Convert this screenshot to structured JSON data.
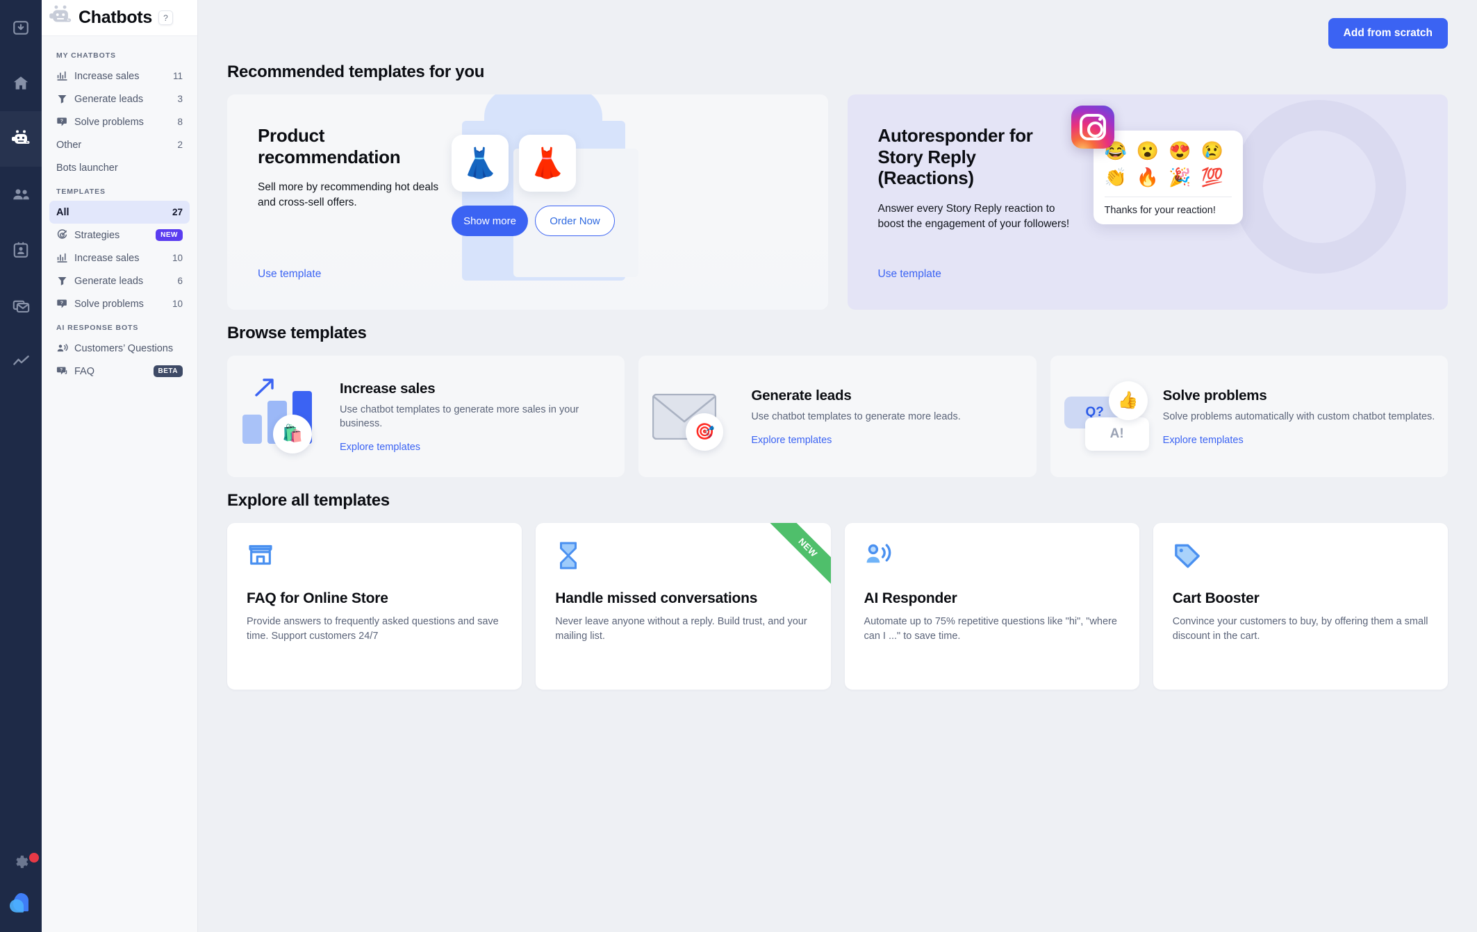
{
  "rail": {
    "items": [
      {
        "icon": "inbox-download-icon",
        "name": "rail-item-archive",
        "active": false
      },
      {
        "icon": "home-icon",
        "name": "rail-item-home",
        "active": false
      },
      {
        "icon": "chatbot-icon",
        "name": "rail-item-chatbots",
        "active": true
      },
      {
        "icon": "team-icon",
        "name": "rail-item-team",
        "active": false
      },
      {
        "icon": "contact-card-icon",
        "name": "rail-item-contacts",
        "active": false
      },
      {
        "icon": "mail-icon",
        "name": "rail-item-campaigns",
        "active": false
      },
      {
        "icon": "chart-line-icon",
        "name": "rail-item-reports",
        "active": false
      }
    ],
    "settings_icon": "gear-icon",
    "brand_icon": "livechat-logo-icon"
  },
  "header": {
    "title": "Chatbots",
    "logo_icon": "chatbot-avatar-icon",
    "help_label": "?"
  },
  "sidebar": {
    "groups": [
      {
        "heading": "MY CHATBOTS",
        "items": [
          {
            "label": "Increase sales",
            "count": "11",
            "icon": "increase-sales-icon"
          },
          {
            "label": "Generate leads",
            "count": "3",
            "icon": "funnel-icon"
          },
          {
            "label": "Solve problems",
            "count": "8",
            "icon": "question-bubble-icon"
          },
          {
            "label": "Other",
            "count": "2",
            "icon": ""
          },
          {
            "label": "Bots launcher",
            "count": "",
            "icon": ""
          }
        ]
      },
      {
        "heading": "TEMPLATES",
        "items": [
          {
            "label": "All",
            "count": "27",
            "icon": "",
            "selected": true
          },
          {
            "label": "Strategies",
            "badge": "NEW",
            "badge_type": "new",
            "icon": "target-icon"
          },
          {
            "label": "Increase sales",
            "count": "10",
            "icon": "increase-sales-icon"
          },
          {
            "label": "Generate leads",
            "count": "6",
            "icon": "funnel-icon"
          },
          {
            "label": "Solve problems",
            "count": "10",
            "icon": "question-bubble-icon"
          }
        ]
      },
      {
        "heading": "AI RESPONSE BOTS",
        "items": [
          {
            "label": "Customers’ Questions",
            "count": "",
            "icon": "person-speaking-icon"
          },
          {
            "label": "FAQ",
            "badge": "BETA",
            "badge_type": "beta",
            "icon": "faq-bubble-icon"
          }
        ]
      }
    ]
  },
  "main": {
    "add_button": "Add from scratch",
    "recommended_heading": "Recommended templates for you",
    "recommended": [
      {
        "title": "Product recommendation",
        "desc": "Sell more by recommending hot deals and cross-sell offers.",
        "link": "Use template",
        "art": {
          "tile_left_emoji": "👗",
          "tile_right_emoji": "👗",
          "button_primary": "Show more",
          "button_secondary": "Order Now"
        }
      },
      {
        "title": "Autoresponder for Story Reply (Reactions)",
        "desc": "Answer every Story Reply reaction to boost the engagement of your followers!",
        "link": "Use template",
        "art": {
          "platform_icon": "instagram-icon",
          "emoji_row_1": [
            "😂",
            "😮",
            "😍",
            "😢"
          ],
          "emoji_row_2": [
            "👏",
            "🔥",
            "🎉",
            "💯"
          ],
          "message": "Thanks for your reaction!"
        }
      }
    ],
    "browse_heading": "Browse templates",
    "browse": [
      {
        "title": "Increase sales",
        "desc": "Use chatbot templates to generate more sales in your business.",
        "link": "Explore templates",
        "art": "bar-chart-shopping-icon"
      },
      {
        "title": "Generate leads",
        "desc": "Use chatbot templates to generate more leads.",
        "link": "Explore templates",
        "art": "envelope-target-icon"
      },
      {
        "title": "Solve problems",
        "desc": "Solve problems automatically with custom chatbot templates.",
        "link": "Explore templates",
        "art": "qa-thumbsup-icon",
        "bubble_q": "Q?",
        "bubble_a": "A!"
      }
    ],
    "explore_heading": "Explore all templates",
    "explore": [
      {
        "title": "FAQ for Online Store",
        "desc": "Provide answers to frequently asked questions and save time. Support customers 24/7",
        "icon": "storefront-icon",
        "ribbon": ""
      },
      {
        "title": "Handle missed conversations",
        "desc": "Never leave anyone without a reply. Build trust, and your mailing list.",
        "icon": "hourglass-icon",
        "ribbon": "NEW"
      },
      {
        "title": "AI Responder",
        "desc": "Automate up to 75% repetitive questions like \"hi\", \"where can I ...\" to save time.",
        "icon": "person-speaking-icon",
        "ribbon": ""
      },
      {
        "title": "Cart Booster",
        "desc": "Convince your customers to buy, by offering them a small discount in the cart.",
        "icon": "price-tag-icon",
        "ribbon": ""
      }
    ]
  },
  "colors": {
    "accent_blue": "#3b63f3",
    "rail_dark": "#1e2a47",
    "badge_new": "#5a3df0",
    "badge_beta": "#3e4a66",
    "ribbon_green": "#4fbf6b",
    "notification_red": "#e63946"
  }
}
